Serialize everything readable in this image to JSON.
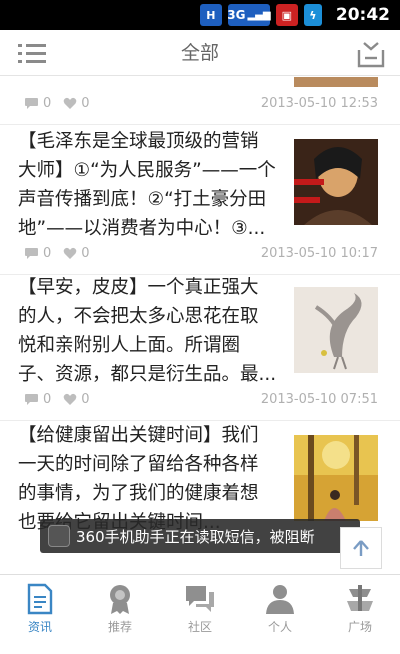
{
  "status_bar": {
    "net_h": "H",
    "net_3g": "3G",
    "time": "20:42"
  },
  "header": {
    "title": "全部"
  },
  "posts": [
    {
      "comments": "0",
      "likes": "0",
      "date": "2013-05-10 12:53"
    },
    {
      "lines": [
        "【毛泽东是全球最顶级的营销",
        "大师】①“为人民服务”——一个",
        "声音传播到底！②“打土豪分田",
        "地”——以消费者为中心！③..."
      ],
      "comments": "0",
      "likes": "0",
      "date": "2013-05-10 10:17",
      "thumb_icon": "portrait-thumbnail"
    },
    {
      "lines": [
        "【早安，皮皮】一个真正强大",
        "的人，不会把太多心思花在取",
        "悦和亲附别人上面。所谓圈",
        "子、资源，都只是衍生品。最..."
      ],
      "comments": "0",
      "likes": "0",
      "date": "2013-05-10 07:51",
      "thumb_icon": "crane-thumbnail"
    },
    {
      "lines": [
        "【给健康留出关键时间】我们",
        "一天的时间除了留给各种各样",
        "的事情，为了我们的健康着想",
        "也要给它留出关键时间..."
      ],
      "thumb_icon": "autumn-thumbnail"
    }
  ],
  "toast": {
    "text": "360手机助手正在读取短信，被阻断"
  },
  "tabs": [
    {
      "label": "资讯",
      "icon": "news-icon",
      "active": true
    },
    {
      "label": "推荐",
      "icon": "medal-icon",
      "active": false
    },
    {
      "label": "社区",
      "icon": "chat-icon",
      "active": false
    },
    {
      "label": "个人",
      "icon": "person-icon",
      "active": false
    },
    {
      "label": "广场",
      "icon": "square-icon",
      "active": false
    }
  ],
  "colors": {
    "accent": "#3a86c4",
    "muted": "#b0b0b0",
    "text": "#222222"
  }
}
